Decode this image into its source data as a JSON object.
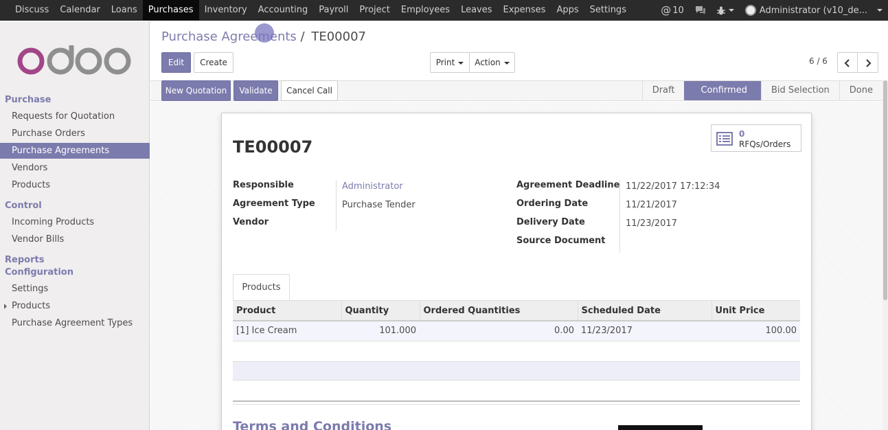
{
  "topbar": {
    "menu": [
      "Discuss",
      "Calendar",
      "Loans",
      "Purchases",
      "Inventory",
      "Accounting",
      "Payroll",
      "Project",
      "Employees",
      "Leaves",
      "Expenses",
      "Apps",
      "Settings"
    ],
    "active_index": 3,
    "mentions_count": "10",
    "user": "Administrator (v10_de..."
  },
  "sidebar": {
    "sections": [
      {
        "label": "Purchase",
        "items": [
          "Requests for Quotation",
          "Purchase Orders",
          "Purchase Agreements",
          "Vendors",
          "Products"
        ]
      },
      {
        "label": "Control",
        "items": [
          "Incoming Products",
          "Vendor Bills"
        ]
      },
      {
        "label": "Reports",
        "items": []
      },
      {
        "label": "Configuration",
        "items": [
          "Settings",
          "Products",
          "Purchase Agreement Types"
        ]
      }
    ],
    "active_item": "Purchase Agreements"
  },
  "breadcrumb": {
    "parent": "Purchase Agreements",
    "separator": "/",
    "current": "TE00007"
  },
  "buttons": {
    "edit": "Edit",
    "create": "Create",
    "print": "Print",
    "action": "Action"
  },
  "pager": {
    "value": "6 / 6"
  },
  "statusbar": {
    "actions": [
      "New Quotation",
      "Validate",
      "Cancel Call"
    ],
    "stages": [
      "Draft",
      "Confirmed",
      "Bid Selection",
      "Done"
    ],
    "current_stage": "Confirmed"
  },
  "smart_button": {
    "count": "0",
    "label": "RFQs/Orders"
  },
  "record": {
    "title": "TE00007",
    "left": [
      {
        "label": "Responsible",
        "value": "Administrator"
      },
      {
        "label": "Agreement Type",
        "value": "Purchase Tender"
      },
      {
        "label": "Vendor",
        "value": ""
      }
    ],
    "right": [
      {
        "label": "Agreement Deadline",
        "value": "11/22/2017 17:12:34"
      },
      {
        "label": "Ordering Date",
        "value": "11/21/2017"
      },
      {
        "label": "Delivery Date",
        "value": "11/23/2017"
      },
      {
        "label": "Source Document",
        "value": ""
      }
    ]
  },
  "tabs": {
    "products": "Products"
  },
  "lines": {
    "headers": [
      "Product",
      "Quantity",
      "Ordered Quantities",
      "Scheduled Date",
      "Unit Price"
    ],
    "rows": [
      [
        "[1] Ice Cream",
        "101.000",
        "0.00",
        "11/23/2017",
        "100.00"
      ]
    ]
  },
  "terms": "Terms and Conditions",
  "colors": {
    "brand": "#7c7bad",
    "navbar": "#2b2b2b"
  }
}
